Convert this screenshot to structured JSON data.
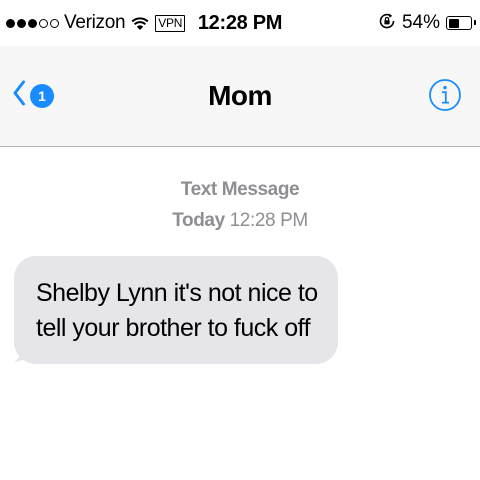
{
  "status_bar": {
    "carrier": "Verizon",
    "vpn": "VPN",
    "time": "12:28 PM",
    "battery_percent": "54%",
    "battery_level": 0.54,
    "signal_bars_filled": 3,
    "signal_bars_total": 5
  },
  "nav": {
    "back_badge": "1",
    "title": "Mom"
  },
  "conversation": {
    "message_type": "Text Message",
    "date_day": "Today",
    "date_time": "12:28 PM",
    "messages": [
      {
        "direction": "incoming",
        "text": "Shelby Lynn it's not nice to tell your brother to fuck off"
      }
    ]
  },
  "colors": {
    "accent": "#1a8cff",
    "bubble_incoming": "#e5e5ea",
    "meta_gray": "#8e8e93"
  },
  "icons": {
    "back": "chevron-left-icon",
    "info": "info-icon",
    "wifi": "wifi-icon",
    "rotation_lock": "rotation-lock-icon",
    "battery": "battery-icon"
  }
}
